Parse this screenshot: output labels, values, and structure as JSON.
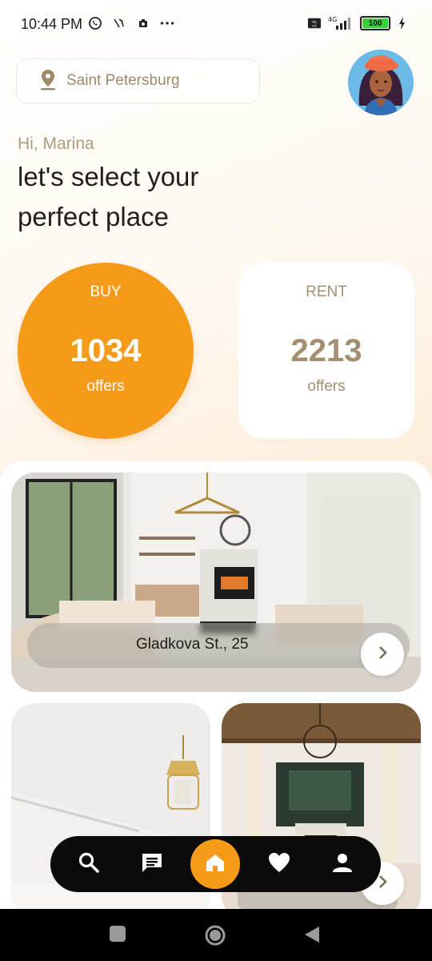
{
  "status_bar": {
    "time": "10:44 PM",
    "network": "4G",
    "battery": "100"
  },
  "location": {
    "label": "Saint Petersburg",
    "icon": "location-pin-icon"
  },
  "greeting": "Hi, Marina",
  "headline": "let's select your perfect place",
  "offers": {
    "buy": {
      "label": "BUY",
      "count": "1034",
      "sub": "offers"
    },
    "rent": {
      "label": "RENT",
      "count": "2213",
      "sub": "offers"
    }
  },
  "listings": [
    {
      "address": "Gladkova St., 25"
    }
  ],
  "bottom_nav": [
    {
      "name": "search-icon",
      "active": false
    },
    {
      "name": "chat-icon",
      "active": false
    },
    {
      "name": "home-icon",
      "active": true
    },
    {
      "name": "heart-icon",
      "active": false
    },
    {
      "name": "profile-icon",
      "active": false
    }
  ],
  "colors": {
    "accent": "#f69b19",
    "muted_text": "#a48e72",
    "nav_bg": "#0b0b0b"
  }
}
